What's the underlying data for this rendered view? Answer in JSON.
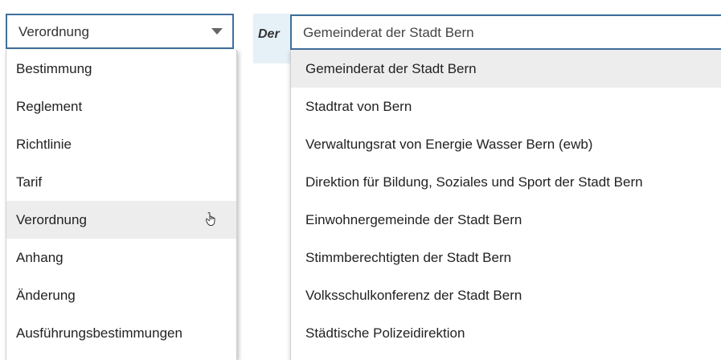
{
  "type_select": {
    "value": "Verordnung",
    "options": [
      "Bestimmung",
      "Reglement",
      "Richtlinie",
      "Tarif",
      "Verordnung",
      "Anhang",
      "Änderung",
      "Ausführungsbestimmungen"
    ],
    "hovered_index": 4
  },
  "der_label": "Der",
  "author_combo": {
    "value": "Gemeinderat der Stadt Bern",
    "options": [
      "Gemeinderat der Stadt Bern",
      "Stadtrat von Bern",
      "Verwaltungsrat von Energie Wasser Bern (ewb)",
      "Direktion für Bildung, Soziales und Sport der Stadt Bern",
      "Einwohnergemeinde der Stadt Bern",
      "Stimmberechtigten der Stadt Bern",
      "Volksschulkonferenz der Stadt Bern",
      "Städtische Polizeidirektion"
    ],
    "highlighted_index": 0
  },
  "icons": {
    "caret": "chevron-down-icon",
    "cursor": "hand-pointer-icon"
  }
}
